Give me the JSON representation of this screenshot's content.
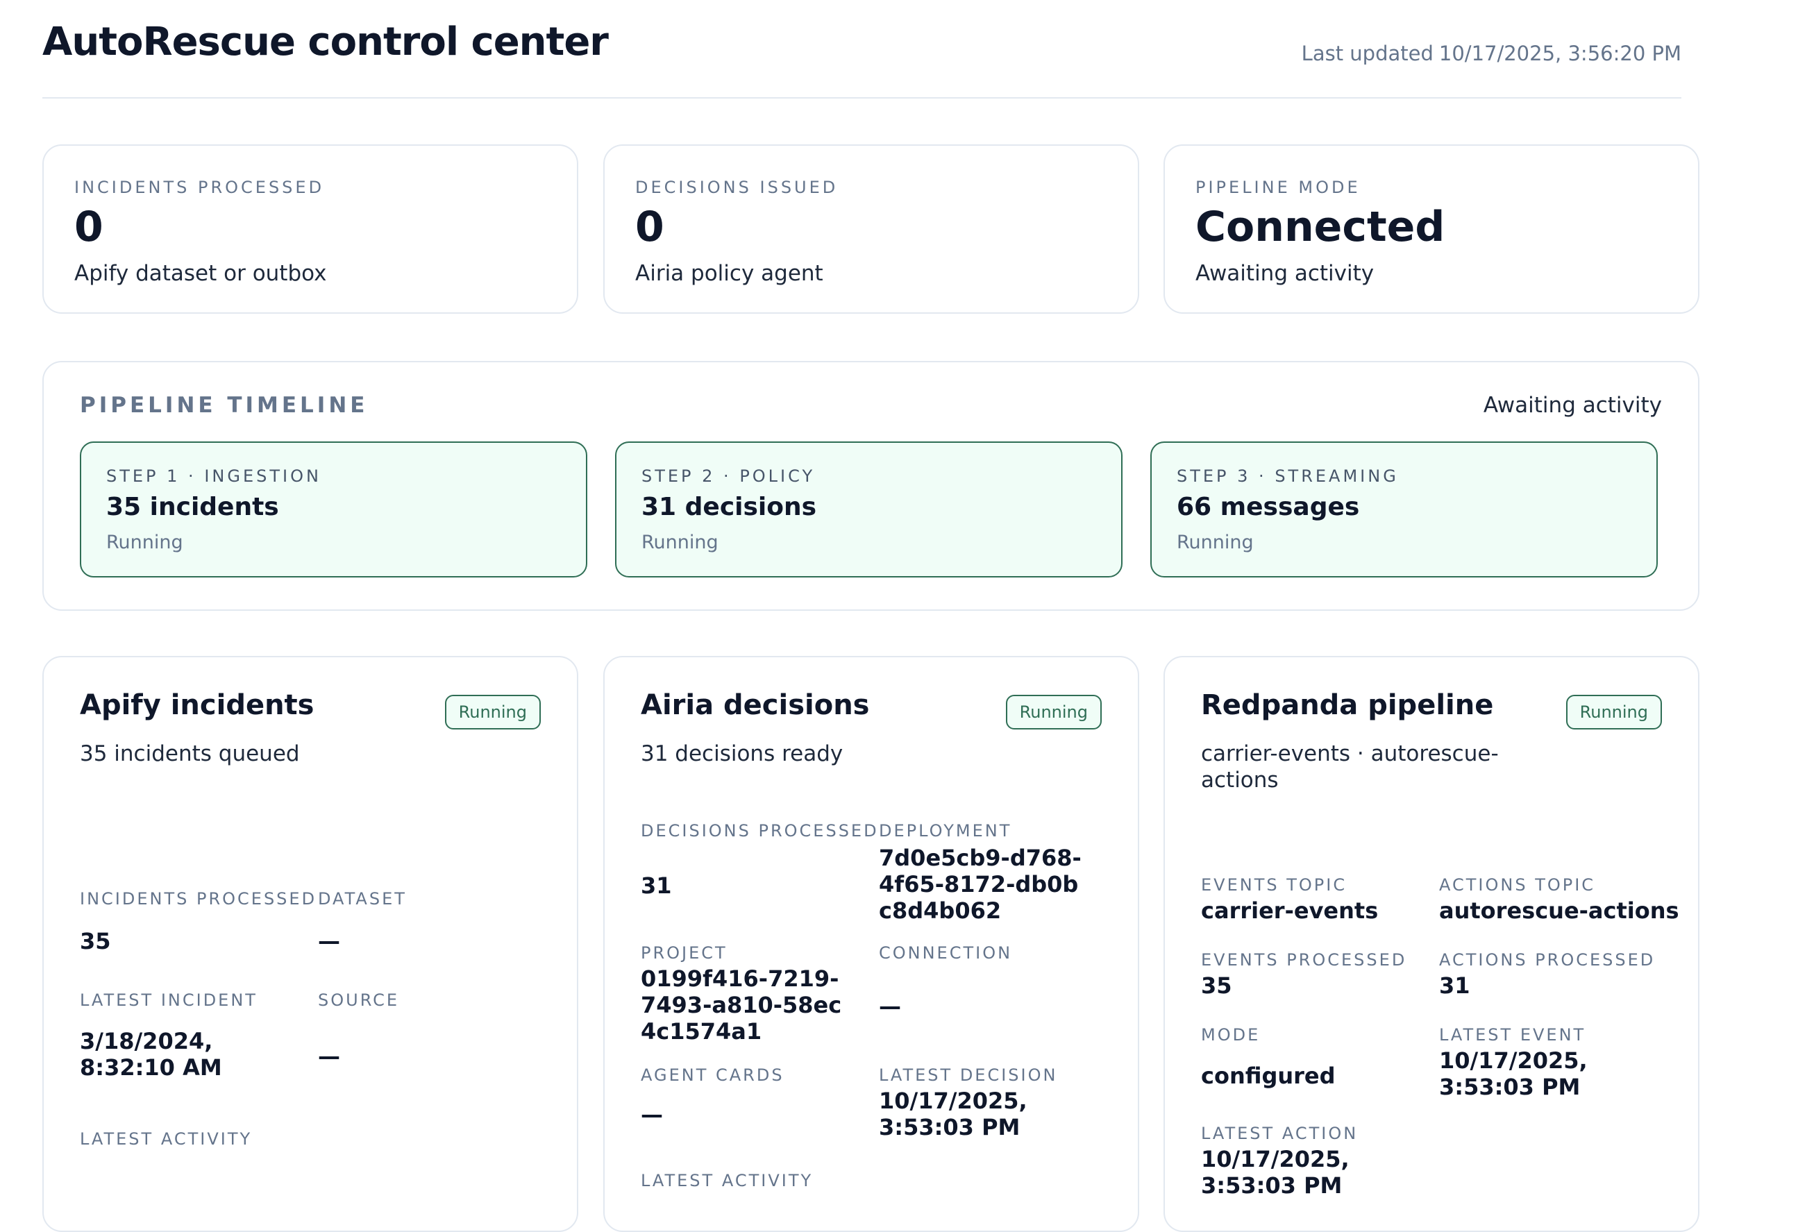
{
  "header": {
    "title": "AutoRescue control center",
    "updated_label": "Last updated",
    "updated_value": "10/17/2025, 3:56:20 PM"
  },
  "stats": [
    {
      "label": "INCIDENTS PROCESSED",
      "value": "0",
      "sub": "Apify dataset or outbox"
    },
    {
      "label": "DECISIONS ISSUED",
      "value": "0",
      "sub": "Airia policy agent"
    },
    {
      "label": "PIPELINE MODE",
      "value": "Connected",
      "sub": "Awaiting activity"
    }
  ],
  "timeline": {
    "heading": "PIPELINE TIMELINE",
    "status": "Awaiting activity",
    "steps": [
      {
        "label": "STEP 1 · INGESTION",
        "value": "35 incidents",
        "status": "Running"
      },
      {
        "label": "STEP 2 · POLICY",
        "value": "31 decisions",
        "status": "Running"
      },
      {
        "label": "STEP 3 · STREAMING",
        "value": "66 messages",
        "status": "Running"
      }
    ]
  },
  "apify": {
    "title": "Apify incidents",
    "badge": "Running",
    "subtitle": "35 incidents queued",
    "fields": {
      "incidents_processed_label": "INCIDENTS PROCESSED",
      "incidents_processed_value": "35",
      "dataset_label": "DATASET",
      "dataset_value": "—",
      "latest_incident_label": "LATEST INCIDENT",
      "latest_incident_value": "3/18/2024, 8:32:10 AM",
      "source_label": "SOURCE",
      "source_value": "—",
      "latest_activity_label": "LATEST ACTIVITY"
    }
  },
  "airia": {
    "title": "Airia decisions",
    "badge": "Running",
    "subtitle": "31 decisions ready",
    "fields": {
      "decisions_processed_label": "DECISIONS PROCESSED",
      "decisions_processed_value": "31",
      "deployment_label": "DEPLOYMENT",
      "deployment_value": "7d0e5cb9-d768-4f65-8172-db0bc8d4b062",
      "project_label": "PROJECT",
      "project_value": "0199f416-7219-7493-a810-58ec4c1574a1",
      "connection_label": "CONNECTION",
      "connection_value": "—",
      "agent_cards_label": "AGENT CARDS",
      "agent_cards_value": "—",
      "latest_decision_label": "LATEST DECISION",
      "latest_decision_value": "10/17/2025, 3:53:03 PM",
      "latest_activity_label": "LATEST ACTIVITY"
    }
  },
  "redpanda": {
    "title": "Redpanda pipeline",
    "badge": "Running",
    "subtitle": "carrier-events · autorescue-actions",
    "fields": {
      "events_topic_label": "EVENTS TOPIC",
      "events_topic_value": "carrier-events",
      "actions_topic_label": "ACTIONS TOPIC",
      "actions_topic_value": "autorescue-actions",
      "events_processed_label": "EVENTS PROCESSED",
      "events_processed_value": "35",
      "actions_processed_label": "ACTIONS PROCESSED",
      "actions_processed_value": "31",
      "mode_label": "MODE",
      "mode_value": "configured",
      "latest_event_label": "LATEST EVENT",
      "latest_event_value": "10/17/2025, 3:53:03 PM",
      "latest_action_label": "LATEST ACTION",
      "latest_action_value": "10/17/2025, 3:53:03 PM"
    }
  }
}
